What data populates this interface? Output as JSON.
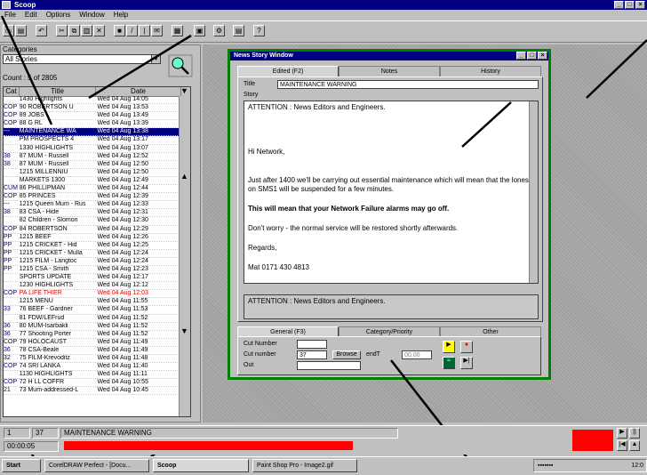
{
  "app": {
    "title": "Scoop"
  },
  "menu": [
    "File",
    "Edit",
    "Options",
    "Window",
    "Help"
  ],
  "left": {
    "categories_label": "Categories",
    "category_selected": "All Stories",
    "count": "Count : 5 of 2805",
    "columns": [
      "Cat",
      "Title",
      "Date"
    ],
    "rows": [
      {
        "cat": "",
        "title": "1430 Highlights",
        "date": "Wed 04 Aug 14:05"
      },
      {
        "cat": "COP",
        "title": "90 ROBERTSON U",
        "date": "Wed 04 Aug 13:53"
      },
      {
        "cat": "COP",
        "title": "89 JOBS",
        "date": "Wed 04 Aug 13:49"
      },
      {
        "cat": "COP",
        "title": "88 G RL",
        "date": "Wed 04 Aug 13:39"
      },
      {
        "cat": "---",
        "title": "MAINTENANCE WA",
        "date": "Wed 04 Aug 13:38",
        "sel": true
      },
      {
        "cat": "",
        "title": "PM PROSPECTS 4",
        "date": "Wed 04 Aug 13:17"
      },
      {
        "cat": "",
        "title": "1330 HIGHLIGHTS",
        "date": "Wed 04 Aug 13:07"
      },
      {
        "cat": "38",
        "title": "87 MUM - Russell",
        "date": "Wed 04 Aug 12:52"
      },
      {
        "cat": "38",
        "title": "87 MUM - Russell",
        "date": "Wed 04 Aug 12:50"
      },
      {
        "cat": "",
        "title": "1215 MILLENNIU",
        "date": "Wed 04 Aug 12:50"
      },
      {
        "cat": "",
        "title": "MARKETS 1300",
        "date": "Wed 04 Aug 12:49"
      },
      {
        "cat": "CUM",
        "title": "86 PHILLIPMAN",
        "date": "Wed 04 Aug 12:44"
      },
      {
        "cat": "COP",
        "title": "85 PRINCES",
        "date": "Wed 04 Aug 12:39"
      },
      {
        "cat": "---",
        "title": "1215 Queen Mum - Rus",
        "date": "Wed 04 Aug 12:33"
      },
      {
        "cat": "38",
        "title": "83 CSA - Hide",
        "date": "Wed 04 Aug 12:31"
      },
      {
        "cat": "",
        "title": "82 Children - Slomon",
        "date": "Wed 04 Aug 12:30"
      },
      {
        "cat": "COP",
        "title": "84 ROBERTSON",
        "date": "Wed 04 Aug 12:29"
      },
      {
        "cat": "PP",
        "title": "1215 BEEF",
        "date": "Wed 04 Aug 12:26"
      },
      {
        "cat": "PP",
        "title": "1215 CRICKET - Hid",
        "date": "Wed 04 Aug 12:25"
      },
      {
        "cat": "PP",
        "title": "1215 CRICKET - Mulla",
        "date": "Wed 04 Aug 12:24"
      },
      {
        "cat": "PP",
        "title": "1215 FILM - Langtoc",
        "date": "Wed 04 Aug 12:24"
      },
      {
        "cat": "PP",
        "title": "1215 CSA - Smith",
        "date": "Wed 04 Aug 12:23"
      },
      {
        "cat": "",
        "title": "SPORTS UPDATE",
        "date": "Wed 04 Aug 12:17"
      },
      {
        "cat": "",
        "title": "1230 HIGHLIGHTS",
        "date": "Wed 04 Aug 12:12"
      },
      {
        "cat": "COP",
        "title": "PA LIFE THIER",
        "date": "Wed 04 Aug 12:03",
        "red": true
      },
      {
        "cat": "",
        "title": "1215 MENU",
        "date": "Wed 04 Aug 11:55"
      },
      {
        "cat": "33",
        "title": "76 BEEF - Gardner",
        "date": "Wed 04 Aug 11:53"
      },
      {
        "cat": "",
        "title": "81 FDW/LEFrud",
        "date": "Wed 04 Aug 11:52"
      },
      {
        "cat": "36",
        "title": "80 MUM-Isarbakli",
        "date": "Wed 04 Aug 11:52"
      },
      {
        "cat": "36",
        "title": "77 Shooting Porter",
        "date": "Wed 04 Aug 11:52"
      },
      {
        "cat": "COP",
        "title": "79 HOLOCAUST",
        "date": "Wed 04 Aug 11:49"
      },
      {
        "cat": "36",
        "title": "78 CSA-Beale",
        "date": "Wed 04 Aug 11:49"
      },
      {
        "cat": "32",
        "title": "75 FILM-Krevoditz",
        "date": "Wed 04 Aug 11:48"
      },
      {
        "cat": "COP",
        "title": "74 SRI LANKA",
        "date": "Wed 04 Aug 11:40"
      },
      {
        "cat": "",
        "title": "1130 HIGHLIGHTS",
        "date": "Wed 04 Aug 11:11"
      },
      {
        "cat": "COP",
        "title": "72 H LL COFFR",
        "date": "Wed 04 Aug 10:55"
      },
      {
        "cat": "21",
        "title": "73 Mum-addressed-L",
        "date": "Wed 04 Aug 10:45"
      }
    ]
  },
  "news_window": {
    "title": "News Story Window",
    "tabs": [
      "Edited (F2)",
      "Notes",
      "History"
    ],
    "title_label": "Title",
    "title_value": "MAINTENANCE WARNING",
    "story_label": "Story",
    "story": [
      "ATTENTION : News Editors and Engineers.",
      "Hi Network,",
      "Just after 1400 we'll be carrying out essential maintenance which will mean that the lones on SMS1 will be suspended for a few minutes.",
      "This will mean that your Network Failure alarms may go off.",
      "Don't worry - the normal service will be restored shortly afterwards.",
      "Regards,",
      "Mat 0171 430 4813"
    ],
    "preview": "ATTENTION : News Editors and Engineers.",
    "bottom_tabs": [
      "General (F3)",
      "Category/Priority",
      "Other"
    ],
    "cut_number_label": "Cut Number",
    "cut_number_value": "",
    "cut_number2_label": "Cut number",
    "cut_number2_value": "37",
    "browse_label": "Browse",
    "endt_label": "endT",
    "endt_value": "00.00",
    "out_label": "Out",
    "out_value": ""
  },
  "status": {
    "number": "1",
    "cut": "37",
    "title": "MAINTENANCE WARNING",
    "time": "00:00:05",
    "progress": 0.86
  },
  "taskbar": {
    "start": "Start",
    "tasks": [
      "CorelDRAW Perfect - [Docu...",
      "Scoop",
      "Paint Shop Pro - Image2.gif"
    ],
    "clock": "12:0"
  }
}
